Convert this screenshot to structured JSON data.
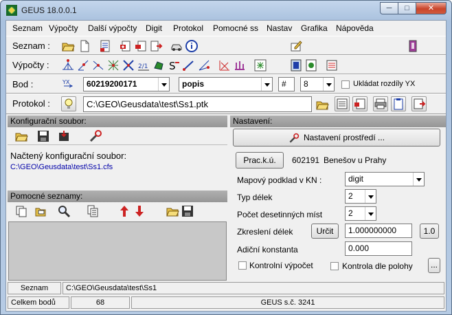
{
  "window": {
    "title": "GEUS 18.0.0.1",
    "minimize": "─",
    "maximize": "□",
    "close": "✕"
  },
  "menu": [
    "Seznam",
    "Výpočty",
    "Další výpočty",
    "Digit",
    "Protokol",
    "Pomocné ss",
    "Nastav",
    "Grafika",
    "Nápověda"
  ],
  "toolbar": {
    "seznam_label": "Seznam :",
    "vypocty_label": "Výpočty :",
    "bod_label": "Bod :",
    "protokol_label": "Protokol :"
  },
  "bod": {
    "number": "60219200171",
    "field": "popis",
    "hash": "#",
    "count": "8",
    "ukladat_label": "Ukládat rozdíly YX"
  },
  "protokol": {
    "path": "C:\\GEO\\Geusdata\\test\\Ss1.ptk"
  },
  "konfig": {
    "header": "Konfigurační soubor:",
    "loaded_label": "Načtený konfigurační soubor:",
    "loaded_path": "C:\\GEO\\Geusdata\\test\\Ss1.cfs"
  },
  "pomocne": {
    "header": "Pomocné seznamy:"
  },
  "nastaveni": {
    "header": "Nastavení:",
    "prostredi_button": "Nastavení prostředí ...",
    "prack_button": "Prac.k.ú.",
    "ku_code": "602191",
    "ku_name": "Benešov u Prahy",
    "mapovy_label": "Mapový podklad v KN :",
    "mapovy_value": "digit",
    "typ_delek_label": "Typ délek",
    "typ_delek_value": "2",
    "pocet_label": "Počet desetinných míst",
    "pocet_value": "2",
    "zkresleni_label": "Zkreslení délek",
    "urcit_button": "Určit",
    "zkresleni_value": "1.000000000",
    "one_button": "1.0",
    "adicni_label": "Adiční konstanta",
    "adicni_value": "0.000",
    "kontrolni_label": "Kontrolní výpočet",
    "kontrola_label": "Kontrola dle polohy",
    "dots_button": "..."
  },
  "status": {
    "seznam_label": "Seznam",
    "seznam_path": "C:\\GEO\\Geusdata\\test\\Ss1",
    "celkem_label": "Celkem bodů",
    "celkem_value": "68",
    "license": "GEUS s.č. 3241"
  },
  "colors": {
    "panel_header": "#a0a0a0",
    "link_blue": "#0000a8",
    "list_bg": "#c8c8c8"
  }
}
